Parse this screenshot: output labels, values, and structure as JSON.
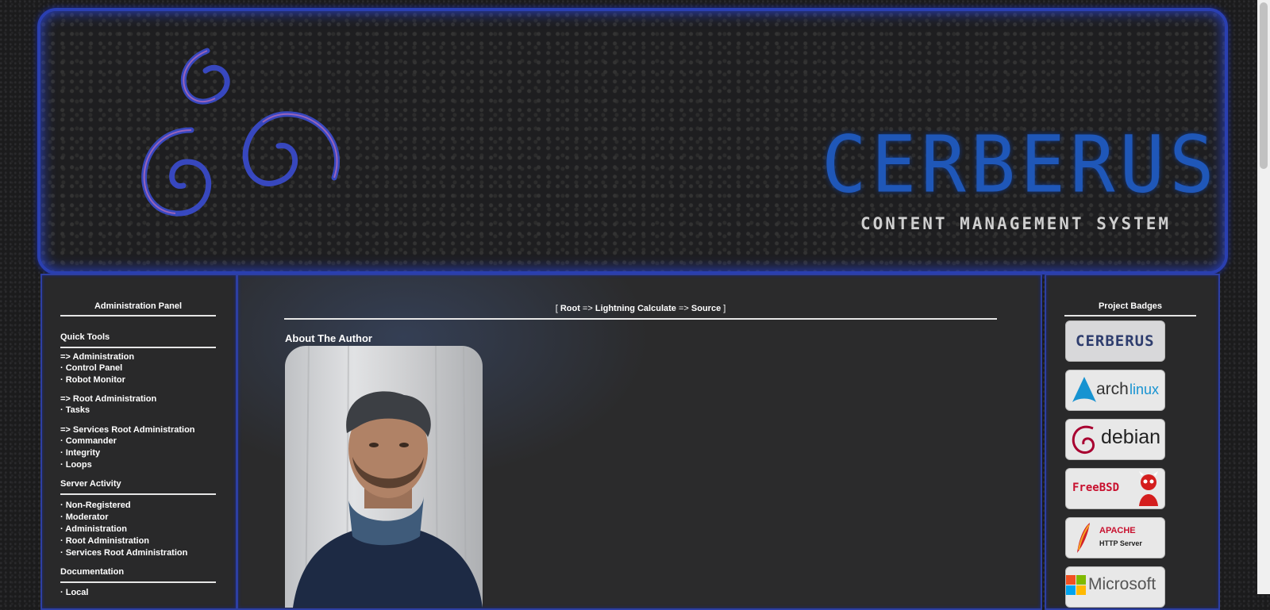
{
  "banner": {
    "title": "CERBERUS",
    "subtitle": "CONTENT MANAGEMENT SYSTEM"
  },
  "left_panel": {
    "title": "Administration Panel",
    "quick_tools": {
      "heading": "Quick Tools",
      "links": [
        "=> Administration",
        "· Control Panel",
        "· Robot Monitor",
        "=> Root Administration",
        "· Tasks",
        "=> Services Root Administration",
        "· Commander",
        "· Integrity",
        "· Loops"
      ]
    },
    "server_activity": {
      "heading": "Server Activity",
      "links": [
        "· Non-Registered",
        "· Moderator",
        "· Administration",
        "· Root Administration",
        "· Services Root Administration"
      ]
    },
    "documentation": {
      "heading": "Documentation",
      "links": [
        "· Local"
      ]
    }
  },
  "center": {
    "breadcrumb": {
      "open": "[",
      "items": [
        "Root",
        "Lightning Calculate",
        "Source"
      ],
      "sep": "=>",
      "close": "]"
    },
    "heading": "About The Author"
  },
  "right_panel": {
    "title": "Project Badges",
    "badges": [
      {
        "name": "cerberus",
        "label": "CERBERUS",
        "color": "#1f3f8a"
      },
      {
        "name": "archlinux",
        "label_a": "arch",
        "label_b": "linux",
        "color": "#1793d1"
      },
      {
        "name": "debian",
        "label": "debian",
        "color": "#a80030"
      },
      {
        "name": "freebsd",
        "label": "FreeBSD",
        "color": "#c8102e"
      },
      {
        "name": "apache",
        "label_a": "APACHE",
        "label_b": "HTTP Server",
        "color": "#c8102e"
      },
      {
        "name": "microsoft",
        "label": "Microsoft",
        "color": "#555555"
      }
    ]
  }
}
